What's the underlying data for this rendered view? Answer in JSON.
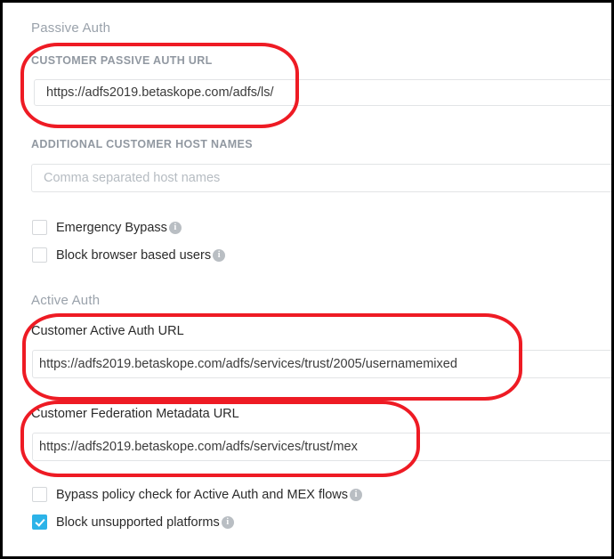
{
  "sections": [
    {
      "id": "passive-auth",
      "heading": "Passive Auth",
      "fields": [
        {
          "label": "CUSTOMER PASSIVE AUTH URL",
          "value": "https://adfs2019.betaskope.com/adfs/ls/",
          "placeholder": ""
        },
        {
          "label": "ADDITIONAL CUSTOMER HOST NAMES",
          "value": "",
          "placeholder": "Comma separated host names"
        }
      ],
      "checkboxes": [
        {
          "label": "Emergency Bypass",
          "checked": false,
          "info": "i"
        },
        {
          "label": "Block browser based users",
          "checked": false,
          "info": "i"
        }
      ]
    },
    {
      "id": "active-auth",
      "heading": "Active Auth",
      "fields": [
        {
          "label": "Customer Active Auth URL",
          "value": "https://adfs2019.betaskope.com/adfs/services/trust/2005/usernamemixed",
          "placeholder": ""
        },
        {
          "label": "Customer Federation Metadata URL",
          "value": "https://adfs2019.betaskope.com/adfs/services/trust/mex",
          "placeholder": ""
        }
      ],
      "checkboxes": [
        {
          "label": "Bypass policy check for Active Auth and MEX flows",
          "checked": false,
          "info": "i"
        },
        {
          "label": "Block unsupported platforms",
          "checked": true,
          "info": "i"
        }
      ]
    }
  ],
  "annotations": [
    {
      "name": "highlight-passive-auth-url",
      "shape": "rounded-rectangle",
      "color": "#ee1b24"
    },
    {
      "name": "highlight-active-auth-url",
      "shape": "rounded-rectangle",
      "color": "#ee1b24"
    },
    {
      "name": "highlight-federation-metadata-url",
      "shape": "rounded-rectangle",
      "color": "#ee1b24"
    }
  ],
  "colors": {
    "annotation_red": "#ee1b24",
    "checkbox_checked": "#2cb3e8",
    "section_heading": "#9aa2ab",
    "label_gray": "#9198a1",
    "label_dark": "#2b2b2b",
    "input_border": "#e2e4e6",
    "placeholder": "#b6bcc2",
    "frame_border": "#000000"
  }
}
